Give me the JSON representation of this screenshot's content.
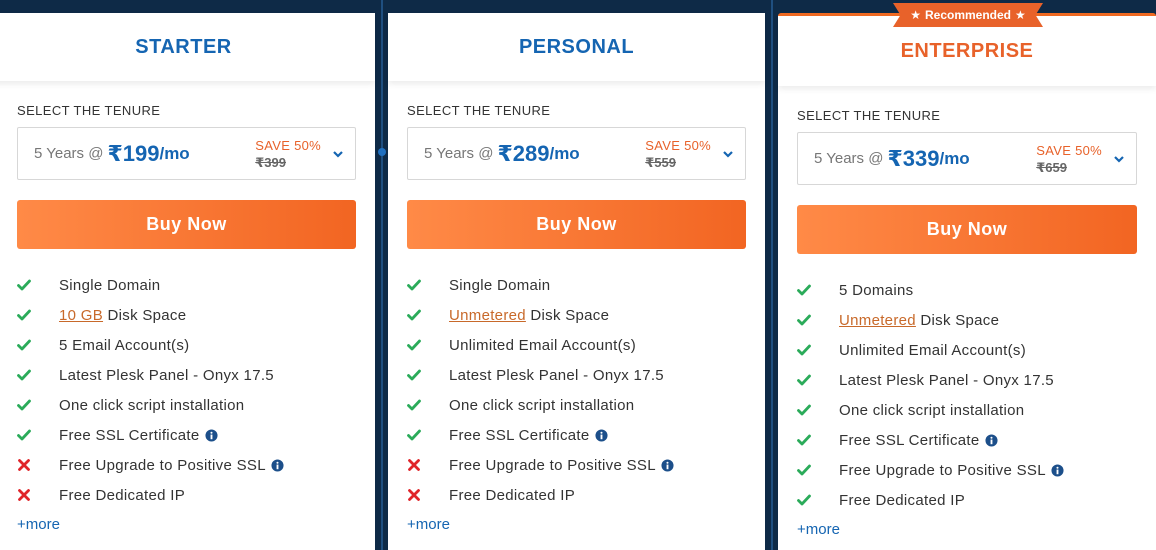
{
  "plans": [
    {
      "title": "STARTER",
      "tenure_label": "SELECT THE TENURE",
      "years": "5 Years @",
      "price": "₹199",
      "per": "/mo",
      "save": "SAVE 50%",
      "old_price": "₹399",
      "buy_label": "Buy Now",
      "features": [
        {
          "pre": "",
          "link": "",
          "post": "Single Domain",
          "icon": "check-icon",
          "info": false
        },
        {
          "pre": "",
          "link": "10 GB",
          "post": " Disk Space",
          "icon": "check-icon",
          "info": false
        },
        {
          "pre": "",
          "link": "",
          "post": "5 Email Account(s)",
          "icon": "check-icon",
          "info": false
        },
        {
          "pre": "",
          "link": "",
          "post": "Latest Plesk Panel - Onyx 17.5",
          "icon": "check-icon",
          "info": false
        },
        {
          "pre": "",
          "link": "",
          "post": "One click script installation",
          "icon": "check-icon",
          "info": false
        },
        {
          "pre": "",
          "link": "",
          "post": "Free SSL Certificate",
          "icon": "check-icon",
          "info": true
        },
        {
          "pre": "",
          "link": "",
          "post": "Free Upgrade to Positive SSL",
          "icon": "cross-icon",
          "info": true
        },
        {
          "pre": "",
          "link": "",
          "post": "Free Dedicated IP",
          "icon": "cross-icon",
          "info": false
        }
      ],
      "more": "+more"
    },
    {
      "title": "PERSONAL",
      "tenure_label": "SELECT THE TENURE",
      "years": "5 Years @",
      "price": "₹289",
      "per": "/mo",
      "save": "SAVE 50%",
      "old_price": "₹559",
      "buy_label": "Buy Now",
      "features": [
        {
          "pre": "",
          "link": "",
          "post": "Single Domain",
          "icon": "check-icon",
          "info": false
        },
        {
          "pre": "",
          "link": "Unmetered",
          "post": " Disk Space",
          "icon": "check-icon",
          "info": false
        },
        {
          "pre": "",
          "link": "",
          "post": "Unlimited Email Account(s)",
          "icon": "check-icon",
          "info": false
        },
        {
          "pre": "",
          "link": "",
          "post": "Latest Plesk Panel - Onyx 17.5",
          "icon": "check-icon",
          "info": false
        },
        {
          "pre": "",
          "link": "",
          "post": "One click script installation",
          "icon": "check-icon",
          "info": false
        },
        {
          "pre": "",
          "link": "",
          "post": "Free SSL Certificate",
          "icon": "check-icon",
          "info": true
        },
        {
          "pre": "",
          "link": "",
          "post": "Free Upgrade to Positive SSL",
          "icon": "cross-icon",
          "info": true
        },
        {
          "pre": "",
          "link": "",
          "post": "Free Dedicated IP",
          "icon": "cross-icon",
          "info": false
        }
      ],
      "more": "+more"
    },
    {
      "title": "ENTERPRISE",
      "badge": "Recommended",
      "tenure_label": "SELECT THE TENURE",
      "years": "5 Years @",
      "price": "₹339",
      "per": "/mo",
      "save": "SAVE 50%",
      "old_price": "₹659",
      "buy_label": "Buy Now",
      "features": [
        {
          "pre": "",
          "link": "",
          "post": "5 Domains",
          "icon": "check-icon",
          "info": false
        },
        {
          "pre": "",
          "link": "Unmetered",
          "post": " Disk Space",
          "icon": "check-icon",
          "info": false
        },
        {
          "pre": "",
          "link": "",
          "post": "Unlimited Email Account(s)",
          "icon": "check-icon",
          "info": false
        },
        {
          "pre": "",
          "link": "",
          "post": "Latest Plesk Panel - Onyx 17.5",
          "icon": "check-icon",
          "info": false
        },
        {
          "pre": "",
          "link": "",
          "post": "One click script installation",
          "icon": "check-icon",
          "info": false
        },
        {
          "pre": "",
          "link": "",
          "post": "Free SSL Certificate",
          "icon": "check-icon",
          "info": true
        },
        {
          "pre": "",
          "link": "",
          "post": "Free Upgrade to Positive SSL",
          "icon": "check-icon",
          "info": true
        },
        {
          "pre": "",
          "link": "",
          "post": "Free Dedicated IP",
          "icon": "check-icon",
          "info": false
        }
      ],
      "more": "+more"
    }
  ],
  "colors": {
    "brand_blue": "#1565b2",
    "accent_orange": "#e8622a",
    "check_green": "#2bab5a",
    "cross_red": "#e0262b",
    "background": "#0e2a47"
  }
}
